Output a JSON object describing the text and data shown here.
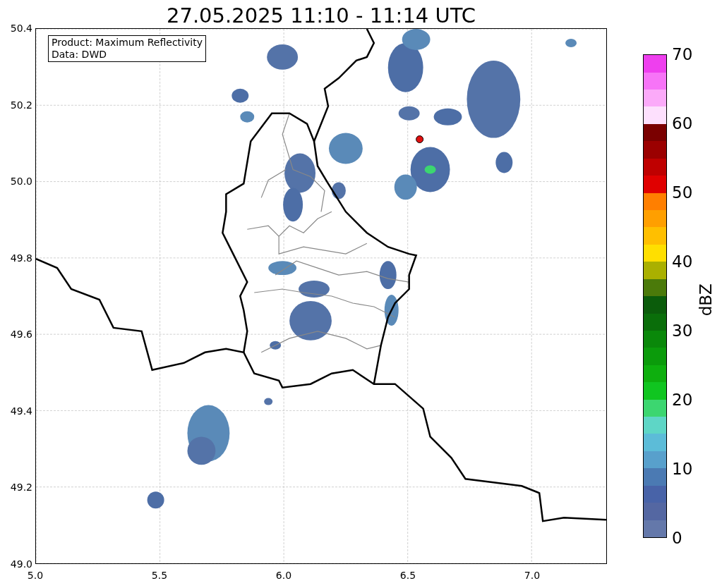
{
  "title": "27.05.2025 11:10 - 11:14 UTC",
  "info_box": [
    "Product: Maximum Reflectivity",
    "Data: DWD"
  ],
  "xticks": [
    "5.0",
    "5.5",
    "6.0",
    "6.5",
    "7.0"
  ],
  "yticks": [
    "50.4",
    "50.2",
    "50.0",
    "49.8",
    "49.6",
    "49.4",
    "49.2",
    "49.0"
  ],
  "colorbar": {
    "label": "dBZ",
    "ticks": [
      "70",
      "60",
      "50",
      "40",
      "30",
      "20",
      "10",
      "0"
    ]
  }
}
